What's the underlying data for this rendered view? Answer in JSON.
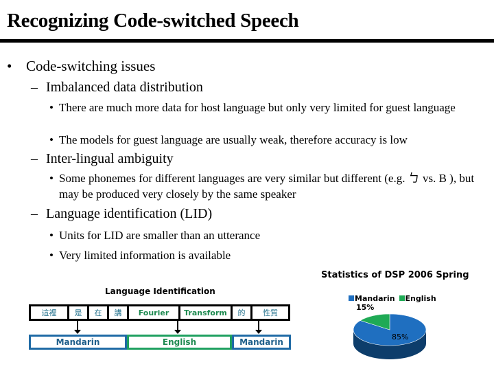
{
  "slide": {
    "title": "Recognizing Code-switched Speech"
  },
  "bullets": {
    "main": {
      "marker": "•",
      "text": "Code-switching issues"
    },
    "sub1": {
      "marker": "–",
      "text": "Imbalanced data distribution",
      "items": [
        "There are much more data for host language but only very limited for guest language",
        "The models for guest language are usually weak, therefore accuracy is low"
      ]
    },
    "sub2": {
      "marker": "–",
      "text": "Inter-lingual ambiguity",
      "items": [
        "Some phonemes for different languages are very similar but different  (e.g. ㄅ vs. B ), but may be produced very closely by the same speaker"
      ]
    },
    "sub3": {
      "marker": "–",
      "text": "Language identification (LID)",
      "items": [
        "Units for LID are smaller than an utterance",
        "Very limited information is available"
      ]
    },
    "small_marker": "•"
  },
  "lid_diagram": {
    "title": "Language Identification",
    "tokens": [
      {
        "text": "這裡",
        "lang": "zh"
      },
      {
        "text": "是",
        "lang": "zh"
      },
      {
        "text": "在",
        "lang": "zh"
      },
      {
        "text": "講",
        "lang": "zh"
      },
      {
        "text": "Fourier",
        "lang": "en"
      },
      {
        "text": "Transform",
        "lang": "en"
      },
      {
        "text": "的",
        "lang": "zh"
      },
      {
        "text": "性質",
        "lang": "zh"
      }
    ],
    "segments": [
      {
        "label": "Mandarin",
        "lang": "zh"
      },
      {
        "label": "English",
        "lang": "en"
      },
      {
        "label": "Mandarin",
        "lang": "zh"
      }
    ],
    "colors": {
      "mandarin": "#1f6aa5",
      "english": "#1fa060"
    }
  },
  "chart_data": {
    "type": "pie",
    "title": "Statistics of DSP 2006 Spring",
    "categories": [
      "Mandarin",
      "English"
    ],
    "values": [
      85,
      15
    ],
    "value_labels": [
      "85%",
      "15%"
    ],
    "colors": [
      "#1f6fc0",
      "#1faa55"
    ],
    "legend_position": "top",
    "style": "3d"
  }
}
